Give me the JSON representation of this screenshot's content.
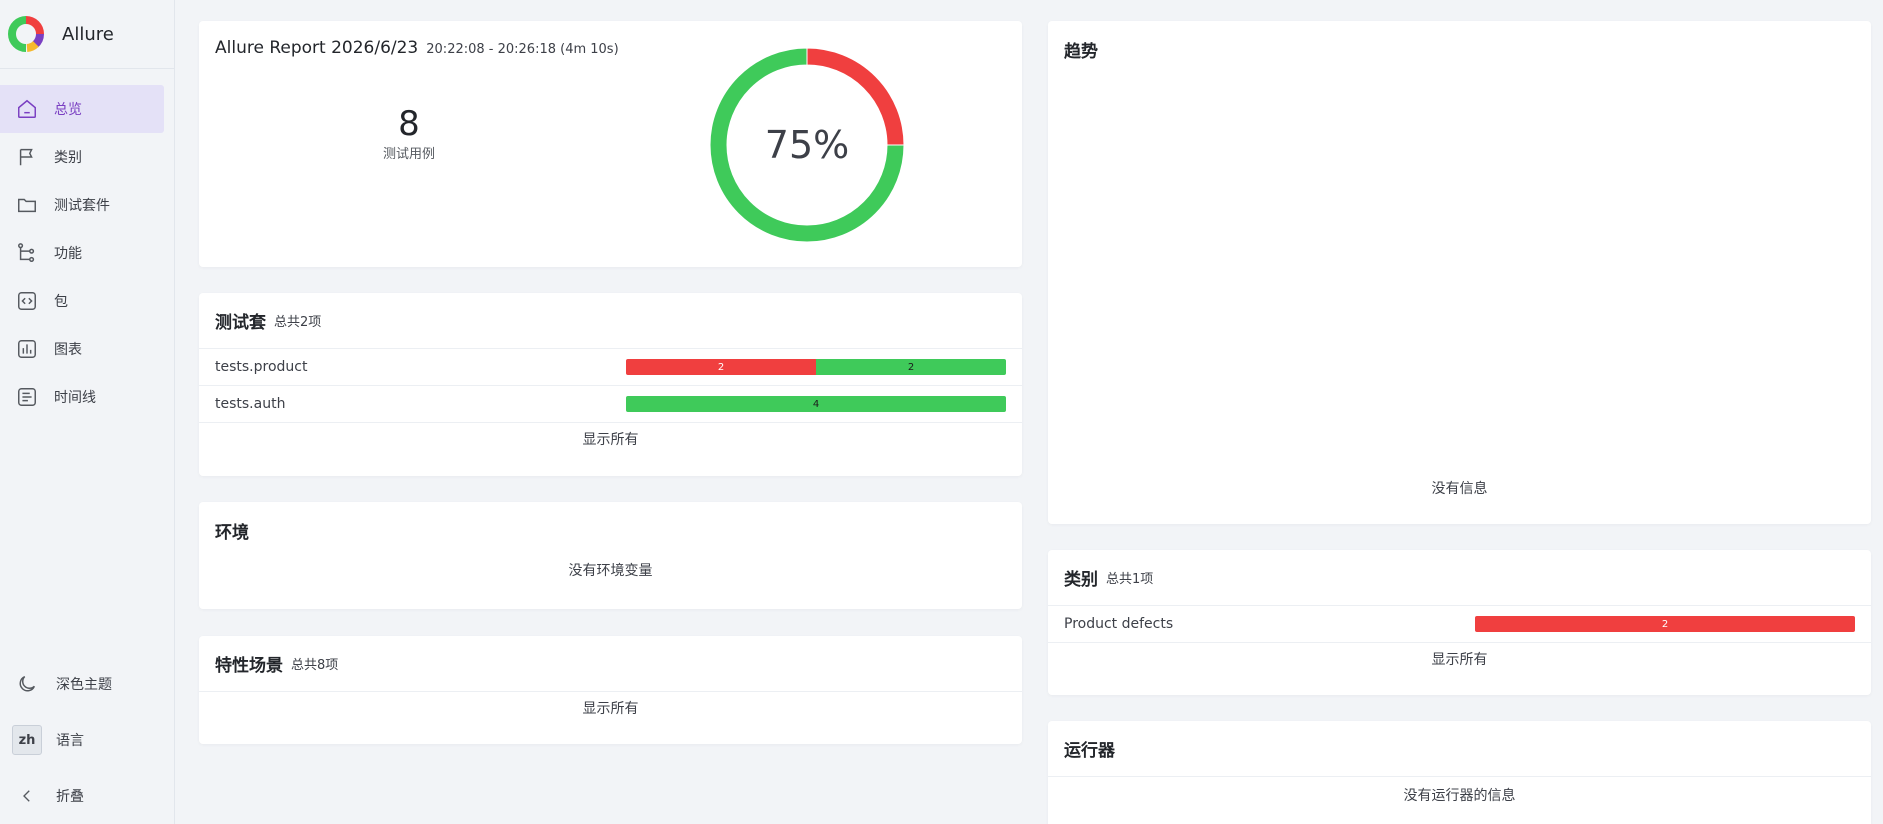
{
  "brand": {
    "name": "Allure"
  },
  "nav": [
    {
      "label": "总览",
      "icon": "home-icon",
      "active": true
    },
    {
      "label": "类别",
      "icon": "flag-icon"
    },
    {
      "label": "测试套件",
      "icon": "folder-icon"
    },
    {
      "label": "功能",
      "icon": "tree-icon"
    },
    {
      "label": "包",
      "icon": "code-icon"
    },
    {
      "label": "图表",
      "icon": "chart-icon"
    },
    {
      "label": "时间线",
      "icon": "timeline-icon"
    }
  ],
  "bottom": {
    "theme": "深色主题",
    "lang_code": "zh",
    "lang": "语言",
    "collapse": "折叠"
  },
  "summary": {
    "title": "Allure Report 2026/6/23",
    "time": "20:22:08 - 20:26:18 (4m 10s)",
    "count": "8",
    "count_label": "测试用例",
    "percent": "75%",
    "passed": 6,
    "failed": 2
  },
  "suites": {
    "title": "测试套",
    "sub": "总共2项",
    "rows": [
      {
        "name": "tests.product",
        "failed": 2,
        "passed": 2,
        "failed_label": "2",
        "passed_label": "2"
      },
      {
        "name": "tests.auth",
        "failed": 0,
        "passed": 4,
        "passed_label": "4"
      }
    ],
    "show_all": "显示所有"
  },
  "env": {
    "title": "环境",
    "empty": "没有环境变量"
  },
  "features": {
    "title": "特性场景",
    "sub": "总共8项",
    "show_all": "显示所有"
  },
  "trend": {
    "title": "趋势",
    "empty": "没有信息"
  },
  "categories": {
    "title": "类别",
    "sub": "总共1项",
    "rows": [
      {
        "name": "Product defects",
        "failed": 2,
        "failed_label": "2"
      }
    ],
    "show_all": "显示所有"
  },
  "executors": {
    "title": "运行器",
    "empty": "没有运行器的信息"
  },
  "colors": {
    "failed": "#f03f3f",
    "passed": "#3fca5a",
    "accent": "#7a3fc2"
  }
}
